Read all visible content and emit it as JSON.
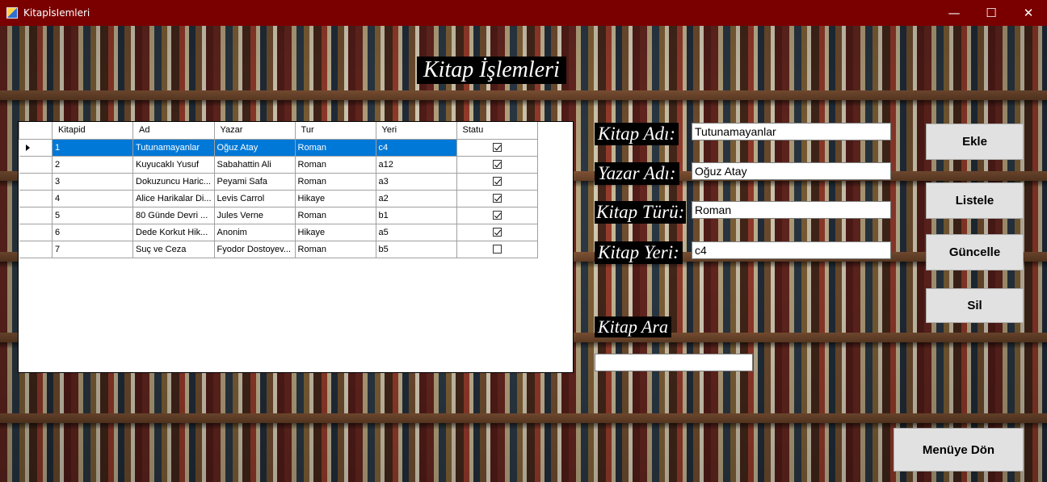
{
  "window": {
    "title": "KitapİsIemleri",
    "minimize_glyph": "—",
    "maximize_glyph": "☐",
    "close_glyph": "✕"
  },
  "header": {
    "title": "Kitap İşlemleri"
  },
  "grid": {
    "columns": [
      "Kitapid",
      "Ad",
      "Yazar",
      "Tur",
      "Yeri",
      "Statu"
    ],
    "selected_row": 0,
    "rows": [
      {
        "id": "1",
        "ad": "Tutunamayanlar",
        "yazar": "Oğuz Atay",
        "tur": "Roman",
        "yeri": "c4",
        "statu": true
      },
      {
        "id": "2",
        "ad": "Kuyucaklı Yusuf",
        "yazar": "Sabahattin Ali",
        "tur": "Roman",
        "yeri": "a12",
        "statu": true
      },
      {
        "id": "3",
        "ad": "Dokuzuncu Haric...",
        "yazar": "Peyami Safa",
        "tur": "Roman",
        "yeri": "a3",
        "statu": true
      },
      {
        "id": "4",
        "ad": "Alice Harikalar Di...",
        "yazar": "Levis Carrol",
        "tur": "Hikaye",
        "yeri": "a2",
        "statu": true
      },
      {
        "id": "5",
        "ad": "80 Günde Devri ...",
        "yazar": "Jules Verne",
        "tur": "Roman",
        "yeri": "b1",
        "statu": true
      },
      {
        "id": "6",
        "ad": "Dede Korkut Hik...",
        "yazar": "Anonim",
        "tur": "Hikaye",
        "yeri": "a5",
        "statu": true
      },
      {
        "id": "7",
        "ad": "Suç ve Ceza",
        "yazar": "Fyodor Dostoyev...",
        "tur": "Roman",
        "yeri": "b5",
        "statu": false
      }
    ]
  },
  "form": {
    "kitap_adi_label": "Kitap Adı:",
    "kitap_adi_value": "Tutunamayanlar",
    "yazar_adi_label": "Yazar Adı:",
    "yazar_adi_value": "Oğuz Atay",
    "kitap_turu_label": "Kitap Türü:",
    "kitap_turu_value": "Roman",
    "kitap_yeri_label": "Kitap Yeri:",
    "kitap_yeri_value": "c4",
    "ara_label": "Kitap Ara",
    "ara_value": ""
  },
  "buttons": {
    "ekle": "Ekle",
    "listele": "Listele",
    "guncelle": "Güncelle",
    "sil": "Sil",
    "menuye_don": "Menüye Dön"
  },
  "colors": {
    "titlebar": "#7a0000",
    "selection": "#0078d7",
    "label_bg": "#000000"
  }
}
